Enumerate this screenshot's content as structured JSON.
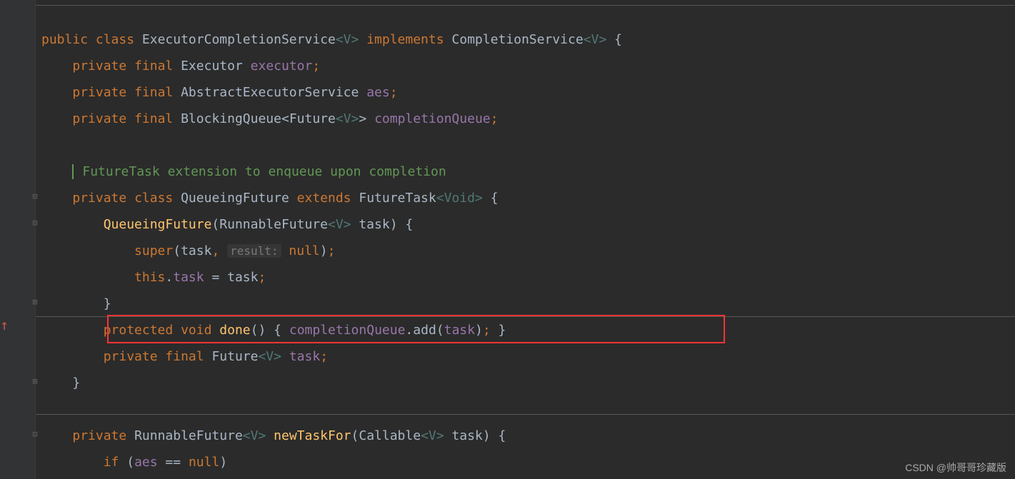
{
  "code": {
    "line1": {
      "kw_public": "public",
      "kw_class": "class",
      "cls": "ExecutorCompletionService",
      "gen": "<V>",
      "kw_implements": "implements",
      "iface": "CompletionService",
      "gen2": "<V>",
      "brace": " {"
    },
    "line2": {
      "kw_private": "private",
      "kw_final": "final",
      "type": "Executor",
      "field": "executor",
      "semi": ";"
    },
    "line3": {
      "kw_private": "private",
      "kw_final": "final",
      "type": "AbstractExecutorService",
      "field": "aes",
      "semi": ";"
    },
    "line4": {
      "kw_private": "private",
      "kw_final": "final",
      "type": "BlockingQueue",
      "gen_open": "<",
      "gen_type": "Future",
      "gen_inner": "<V>",
      "gen_close": ">",
      "field": "completionQueue",
      "semi": ";"
    },
    "line5": "",
    "line6": "",
    "comment": "FutureTask extension to enqueue upon completion",
    "line8": {
      "kw_private": "private",
      "kw_class": "class",
      "cls": "QueueingFuture",
      "kw_extends": "extends",
      "parent": "FutureTask",
      "gen": "<Void>",
      "brace": " {"
    },
    "line9": {
      "ctor": "QueueingFuture",
      "paren_open": "(",
      "ptype": "RunnableFuture",
      "pgen": "<V>",
      "pname": "task",
      "paren_close": ")",
      "brace": " {"
    },
    "line10": {
      "super": "super",
      "paren_open": "(",
      "arg1": "task",
      "comma": ",",
      "hint": "result:",
      "null": "null",
      "paren_close": ")",
      "semi": ";"
    },
    "line11": {
      "this": "this",
      "dot": ".",
      "field": "task",
      "eq": " = ",
      "rhs": "task",
      "semi": ";"
    },
    "line12": {
      "brace": "}"
    },
    "line13": {
      "kw_protected": "protected",
      "kw_void": "void",
      "method": "done",
      "parens": "()",
      "brace_open": " { ",
      "field": "completionQueue",
      "dot": ".",
      "call": "add",
      "paren_open": "(",
      "arg": "task",
      "paren_close": ")",
      "semi": ";",
      "brace_close": " }"
    },
    "line14": {
      "kw_private": "private",
      "kw_final": "final",
      "type": "Future",
      "gen": "<V>",
      "field": "task",
      "semi": ";"
    },
    "line15": {
      "brace": "}"
    },
    "line16": "",
    "line17": "",
    "line18": {
      "kw_private": "private",
      "rtype": "RunnableFuture",
      "gen": "<V>",
      "method": "newTaskFor",
      "paren_open": "(",
      "ptype": "Callable",
      "pgen": "<V>",
      "pname": "task",
      "paren_close": ")",
      "brace": " {"
    },
    "line19": {
      "kw_if": "if",
      "paren_open": " (",
      "field": "aes",
      "eq": " == ",
      "null": "null",
      "paren_close": ")"
    }
  },
  "watermark": "CSDN @帅哥哥珍藏版"
}
